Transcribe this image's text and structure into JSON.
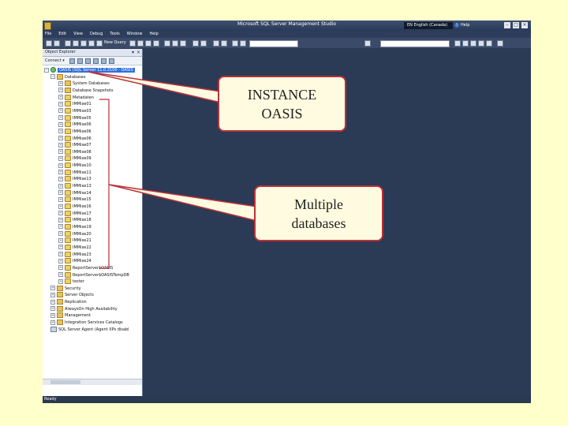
{
  "window": {
    "title": "Microsoft SQL Server Management Studio",
    "language": "EN English (Canada)",
    "help": "Help"
  },
  "menu": [
    "File",
    "Edit",
    "View",
    "Debug",
    "Tools",
    "Window",
    "Help"
  ],
  "toolbar": {
    "new_query": "New Query"
  },
  "object_explorer": {
    "title": "Object Explorer",
    "connect": "Connect ▾",
    "server_node": "OASIS (SQL Server 11.0.2100 - OASIS",
    "databases_node": "Databases",
    "system_databases": "System Databases",
    "snapshots": "Database Snapshots",
    "databases": [
      "Metadaten",
      "IMMixe01",
      "IMMixe03",
      "IMMixe05",
      "IMMixe06",
      "IMMixe06",
      "IMMixe06",
      "IMMixe07",
      "IMMixe08",
      "IMMixe09",
      "IMMixe10",
      "IMMixe11",
      "IMMixe13",
      "IMMixe13",
      "IMMixe14",
      "IMMixe15",
      "IMMixe16",
      "IMMixe17",
      "IMMixe18",
      "IMMixe19",
      "IMMixe20",
      "IMMixe21",
      "IMMixe22",
      "IMMixe23",
      "IMMixe24",
      "ReportServer$OASIS",
      "ReportServer$OASISTempDB",
      "tester"
    ],
    "top_nodes": [
      "Security",
      "Server Objects",
      "Replication",
      "AlwaysOn High Availability",
      "Management",
      "Integration Services Catalogs"
    ],
    "agent": "SQL Server Agent (Agent XPs disabl"
  },
  "status": "Ready",
  "callouts": {
    "instance": "INSTANCE\nOASIS",
    "databases": "Multiple\ndatabases"
  },
  "colors": {
    "slide_background": "#ffffcc",
    "ide_background": "#2b3a55",
    "callout_border": "#b8323a",
    "callout_fill": "#fffbe0"
  }
}
